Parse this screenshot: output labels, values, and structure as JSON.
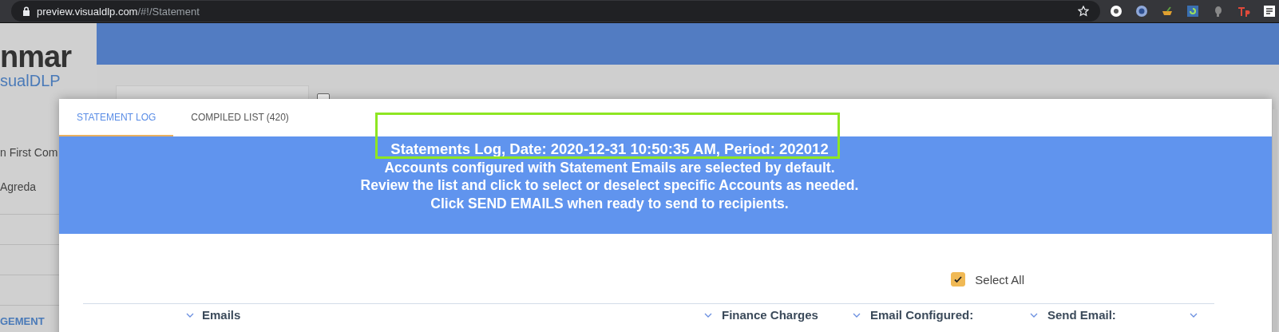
{
  "browser": {
    "url_host": "preview.visualdlp.com",
    "url_path": "/#!/Statement"
  },
  "sidebar": {
    "logo_text": "nmar",
    "logo_subtext": "sualDLP",
    "items": [
      "n First Com",
      "Agreda"
    ],
    "section": "GEMENT"
  },
  "background_checkbox": {
    "checked": false
  },
  "modal": {
    "tabs": [
      {
        "label": "STATEMENT LOG",
        "selected": true
      },
      {
        "label": "COMPILED LIST (420)",
        "selected": false
      }
    ],
    "banner": {
      "title": "Statements Log, Date: 2020-12-31 10:50:35 AM, Period: 202012",
      "lines": [
        "Accounts configured with Statement Emails are selected by default.",
        "Review the list and click to select or deselect specific Accounts as needed.",
        "Click SEND EMAILS when ready to send to recipients."
      ]
    },
    "select_all": {
      "label": "Select All",
      "checked": true
    },
    "columns": [
      {
        "label": "Emails"
      },
      {
        "label": "Finance Charges"
      },
      {
        "label": "Email Configured:"
      },
      {
        "label": "Send Email:"
      }
    ]
  }
}
